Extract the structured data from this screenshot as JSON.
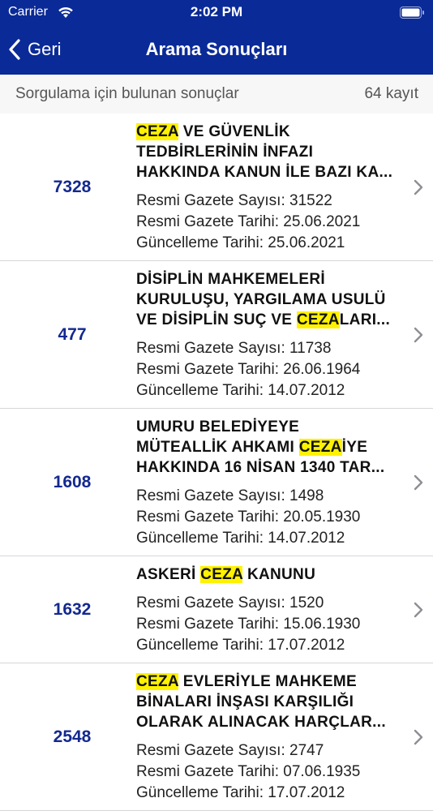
{
  "status": {
    "carrier": "Carrier",
    "time": "2:02 PM"
  },
  "nav": {
    "back_label": "Geri",
    "title": "Arama Sonuçları"
  },
  "summary": {
    "label": "Sorgulama için bulunan sonuçlar",
    "count": "64 kayıt"
  },
  "results": [
    {
      "number": "7328",
      "title_lines": [
        [
          {
            "t": "CEZA",
            "h": true
          },
          {
            "t": " VE GÜVENLİK",
            "h": false
          }
        ],
        [
          {
            "t": "TEDBİRLERİNİN İNFAZI",
            "h": false
          }
        ],
        [
          {
            "t": "HAKKINDA KANUN İLE BAZI KA...",
            "h": false
          }
        ]
      ],
      "sayi": "Resmi Gazete Sayısı: 31522",
      "tarih": "Resmi Gazete Tarihi: 25.06.2021",
      "guncelleme": "Güncelleme Tarihi: 25.06.2021"
    },
    {
      "number": "477",
      "title_lines": [
        [
          {
            "t": "DİSİPLİN MAHKEMELERİ",
            "h": false
          }
        ],
        [
          {
            "t": "KURULUŞU, YARGILAMA USULÜ",
            "h": false
          }
        ],
        [
          {
            "t": "VE DİSİPLİN SUÇ VE ",
            "h": false
          },
          {
            "t": "CEZA",
            "h": true
          },
          {
            "t": "LARI...",
            "h": false
          }
        ]
      ],
      "sayi": "Resmi Gazete Sayısı: 11738",
      "tarih": "Resmi Gazete Tarihi: 26.06.1964",
      "guncelleme": "Güncelleme Tarihi: 14.07.2012"
    },
    {
      "number": "1608",
      "title_lines": [
        [
          {
            "t": "UMURU BELEDİYEYE",
            "h": false
          }
        ],
        [
          {
            "t": "MÜTEALLİK AHKAMI ",
            "h": false
          },
          {
            "t": "CEZA",
            "h": true
          },
          {
            "t": "İYE",
            "h": false
          }
        ],
        [
          {
            "t": "HAKKINDA 16 NİSAN 1340 TAR...",
            "h": false
          }
        ]
      ],
      "sayi": "Resmi Gazete Sayısı: 1498",
      "tarih": "Resmi Gazete Tarihi: 20.05.1930",
      "guncelleme": "Güncelleme Tarihi: 14.07.2012"
    },
    {
      "number": "1632",
      "title_lines": [
        [
          {
            "t": "ASKERİ ",
            "h": false
          },
          {
            "t": "CEZA",
            "h": true
          },
          {
            "t": " KANUNU",
            "h": false
          }
        ]
      ],
      "sayi": "Resmi Gazete Sayısı: 1520",
      "tarih": "Resmi Gazete Tarihi: 15.06.1930",
      "guncelleme": "Güncelleme Tarihi: 17.07.2012"
    },
    {
      "number": "2548",
      "title_lines": [
        [
          {
            "t": "CEZA",
            "h": true
          },
          {
            "t": " EVLERİYLE MAHKEME",
            "h": false
          }
        ],
        [
          {
            "t": "BİNALARI İNŞASI KARŞILIĞI",
            "h": false
          }
        ],
        [
          {
            "t": "OLARAK ALINACAK HARÇLAR...",
            "h": false
          }
        ]
      ],
      "sayi": "Resmi Gazete Sayısı: 2747",
      "tarih": "Resmi Gazete Tarihi: 07.06.1935",
      "guncelleme": "Güncelleme Tarihi: 17.07.2012"
    }
  ],
  "colors": {
    "nav_bg": "#0a2a97",
    "number": "#13298f",
    "highlight": "#fff200"
  },
  "icons": {
    "back": "chevron-left-icon",
    "row": "chevron-right-icon",
    "wifi": "wifi-icon",
    "battery": "battery-icon"
  }
}
